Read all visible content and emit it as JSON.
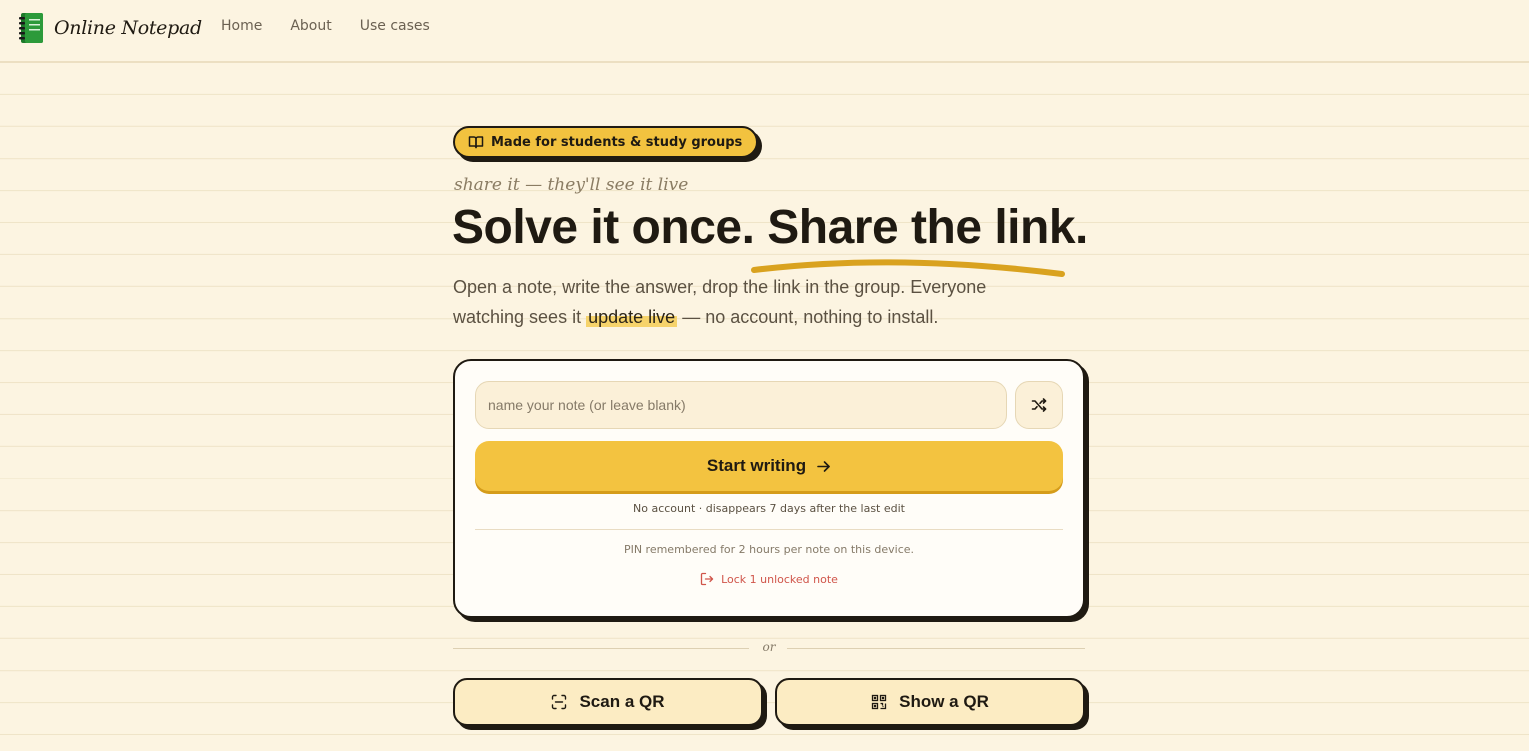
{
  "header": {
    "logo_text": "Online Notepad",
    "nav": [
      "Home",
      "About",
      "Use cases"
    ]
  },
  "hero": {
    "badge": "Made for students & study groups",
    "tagline": "share it — they'll see it live",
    "headline_part1": "Solve it once.",
    "headline_part2": "Share the link.",
    "lede_part1": "Open a note, write the answer, drop the link in the group. Everyone watching sees it",
    "lede_highlight": "update live",
    "lede_part2": "— no account, nothing to install."
  },
  "card": {
    "name_placeholder": "name your note (or leave blank)",
    "start_label": "Start writing",
    "meta": "No account · disappears 7 days after the last edit",
    "pin_note": "PIN remembered for 2 hours per note on this device.",
    "lock_label": "Lock 1 unlocked note"
  },
  "or_label": "or",
  "qr": {
    "scan_label": "Scan a QR",
    "show_label": "Show a QR"
  },
  "colors": {
    "background": "#fcf4e1",
    "accent": "#f3c340",
    "ink": "#1f1a12",
    "danger": "#d0554a"
  }
}
